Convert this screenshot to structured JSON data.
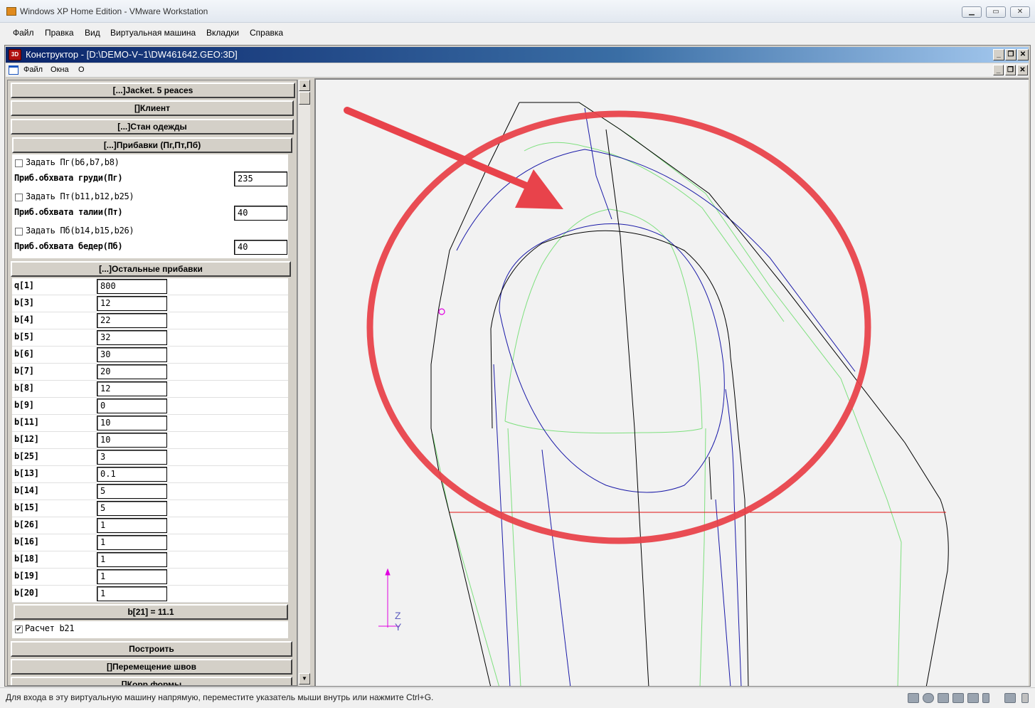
{
  "vm": {
    "title": "Windows XP Home Edition - VMware Workstation",
    "menu": [
      "Файл",
      "Правка",
      "Вид",
      "Виртуальная машина",
      "Вкладки",
      "Справка"
    ],
    "status_text": "Для входа в эту виртуальную машину напрямую, переместите указатель мыши внутрь или нажмите Ctrl+G."
  },
  "window": {
    "title": "Конструктор - [D:\\DEMO-V~1\\DW461642.GEO:3D]",
    "icon_label": "3D",
    "menu": [
      "Файл",
      "Окна",
      "O"
    ],
    "minimize": "_",
    "restore": "❐",
    "close": "✕"
  },
  "panel": {
    "jacket": "[...]Jacket. 5 peaces",
    "client": "[]Клиент",
    "stan": "[...]Стан одежды",
    "pribavki": "[...]Прибавки (Пг,Пт,Пб)",
    "set_pg": "Задать Пг(b6,b7,b8)",
    "pg_label": "Приб.обхвата груди(Пг)",
    "pg_value": "235",
    "set_pt": "Задать Пт(b11,b12,b25)",
    "pt_label": "Приб.обхвата талии(Пт)",
    "pt_value": "40",
    "set_pb": "Задать Пб(b14,b15,b26)",
    "pb_label": "Приб.обхвата бедер(Пб)",
    "pb_value": "40",
    "ostalnye": "[...]Остальные прибавки",
    "params": [
      {
        "label": "q[1]",
        "value": "800"
      },
      {
        "label": "b[3]",
        "value": "12"
      },
      {
        "label": "b[4]",
        "value": "22"
      },
      {
        "label": "b[5]",
        "value": "32"
      },
      {
        "label": "b[6]",
        "value": "30"
      },
      {
        "label": "b[7]",
        "value": "20"
      },
      {
        "label": "b[8]",
        "value": "12"
      },
      {
        "label": "b[9]",
        "value": "0"
      },
      {
        "label": "b[11]",
        "value": "10"
      },
      {
        "label": "b[12]",
        "value": "10"
      },
      {
        "label": "b[25]",
        "value": "3"
      },
      {
        "label": "b[13]",
        "value": "0.1"
      },
      {
        "label": "b[14]",
        "value": "5"
      },
      {
        "label": "b[15]",
        "value": "5"
      },
      {
        "label": "b[26]",
        "value": "1"
      },
      {
        "label": "b[16]",
        "value": "1"
      },
      {
        "label": "b[18]",
        "value": "1"
      },
      {
        "label": "b[19]",
        "value": "1"
      },
      {
        "label": "b[20]",
        "value": "1"
      }
    ],
    "b21": "b[21]  = 11.1",
    "raschet": "Расчет b21",
    "raschet_checked": "✔",
    "postroit": "Построить",
    "peremeshenie": "[]Перемещение швов",
    "korr": "[]Корр.формы"
  },
  "canvas": {
    "axis_z": "Z",
    "axis_y": "Y",
    "colors": {
      "black_line": "#000000",
      "blue_line": "#1a1aa8",
      "green_line": "#7ee07e",
      "red_line": "#e01010",
      "annotation": "#e8434b",
      "axis": "#e000e0"
    }
  }
}
